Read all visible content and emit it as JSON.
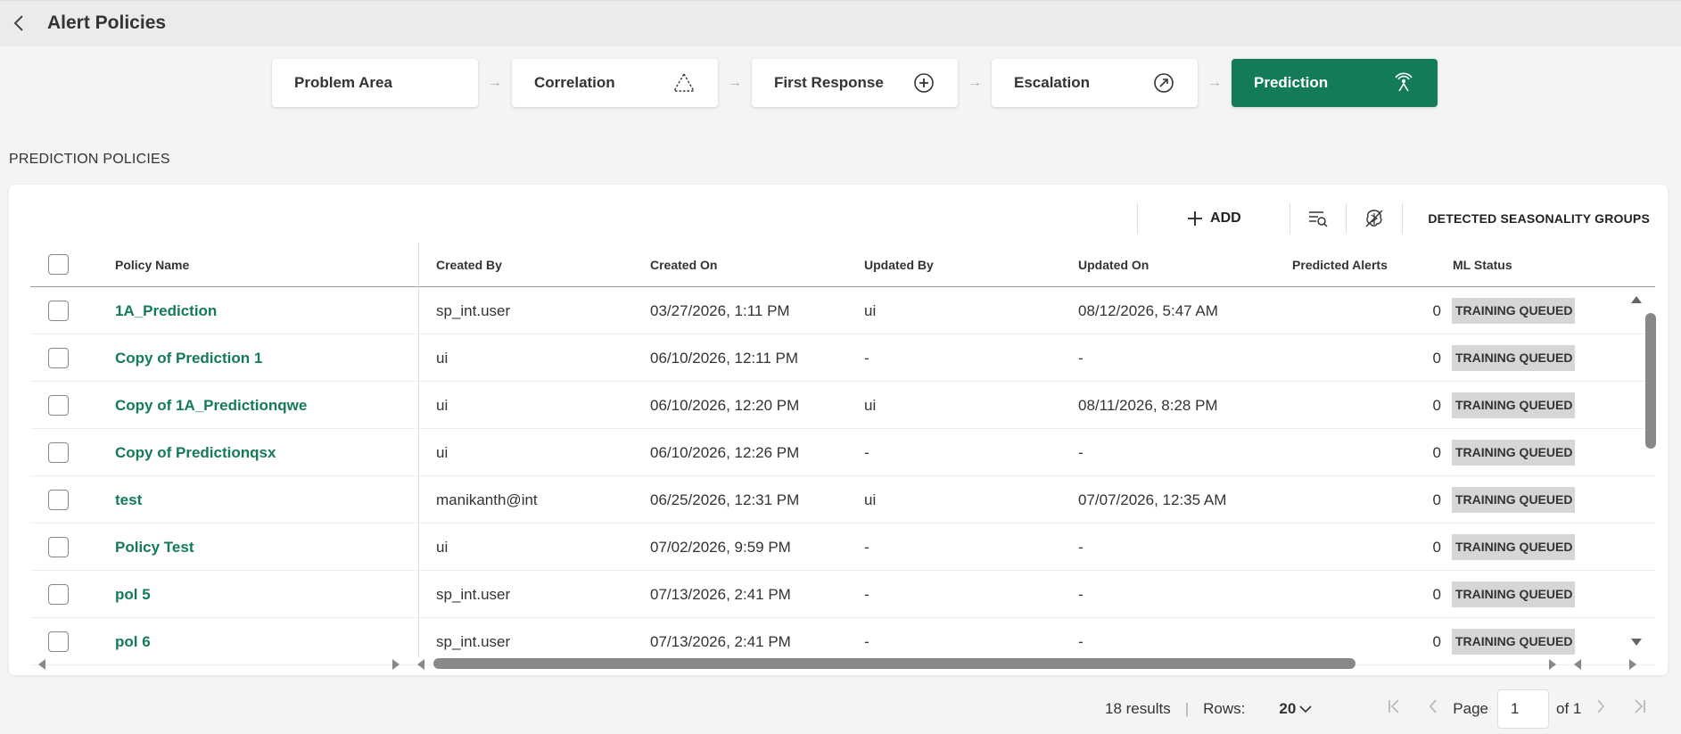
{
  "header": {
    "title": "Alert Policies"
  },
  "steps": [
    {
      "label": "Problem Area",
      "icon": "none"
    },
    {
      "label": "Correlation",
      "icon": "triangle-dashed-icon"
    },
    {
      "label": "First Response",
      "icon": "plus-circle-icon"
    },
    {
      "label": "Escalation",
      "icon": "gauge-arrow-icon"
    },
    {
      "label": "Prediction",
      "icon": "signal-person-icon",
      "active": true
    }
  ],
  "section": {
    "title": "PREDICTION POLICIES"
  },
  "toolbar": {
    "add_label": "ADD",
    "seasonality_label": "DETECTED SEASONALITY GROUPS"
  },
  "table": {
    "columns": [
      "Policy Name",
      "Created By",
      "Created On",
      "Updated By",
      "Updated On",
      "Predicted Alerts",
      "ML Status"
    ],
    "rows": [
      {
        "name": "1A_Prediction",
        "created_by": "sp_int.user",
        "created_on": "03/27/2026, 1:11 PM",
        "updated_by": "ui",
        "updated_on": "08/12/2026, 5:47 AM",
        "predicted": "0",
        "status": "TRAINING QUEUED"
      },
      {
        "name": "Copy of Prediction 1",
        "created_by": "ui",
        "created_on": "06/10/2026, 12:11 PM",
        "updated_by": "-",
        "updated_on": "-",
        "predicted": "0",
        "status": "TRAINING QUEUED"
      },
      {
        "name": "Copy of 1A_Predictionqwe",
        "created_by": "ui",
        "created_on": "06/10/2026, 12:20 PM",
        "updated_by": "ui",
        "updated_on": "08/11/2026, 8:28 PM",
        "predicted": "0",
        "status": "TRAINING QUEUED"
      },
      {
        "name": "Copy of Predictionqsx",
        "created_by": "ui",
        "created_on": "06/10/2026, 12:26 PM",
        "updated_by": "-",
        "updated_on": "-",
        "predicted": "0",
        "status": "TRAINING QUEUED"
      },
      {
        "name": "test",
        "created_by": "manikanth@int",
        "created_on": "06/25/2026, 12:31 PM",
        "updated_by": "ui",
        "updated_on": "07/07/2026, 12:35 AM",
        "predicted": "0",
        "status": "TRAINING QUEUED"
      },
      {
        "name": "Policy Test",
        "created_by": "ui",
        "created_on": "07/02/2026, 9:59 PM",
        "updated_by": "-",
        "updated_on": "-",
        "predicted": "0",
        "status": "TRAINING QUEUED"
      },
      {
        "name": "pol 5",
        "created_by": "sp_int.user",
        "created_on": "07/13/2026, 2:41 PM",
        "updated_by": "-",
        "updated_on": "-",
        "predicted": "0",
        "status": "TRAINING QUEUED"
      },
      {
        "name": "pol 6",
        "created_by": "sp_int.user",
        "created_on": "07/13/2026, 2:41 PM",
        "updated_by": "-",
        "updated_on": "-",
        "predicted": "0",
        "status": "TRAINING QUEUED"
      }
    ]
  },
  "pagination": {
    "results": "18 results",
    "rows_label": "Rows:",
    "rows_value": "20",
    "page_label": "Page",
    "page_value": "1",
    "of_label": "of 1"
  },
  "colors": {
    "accent": "#137a5a",
    "badge_bg": "#d6d6d6"
  }
}
